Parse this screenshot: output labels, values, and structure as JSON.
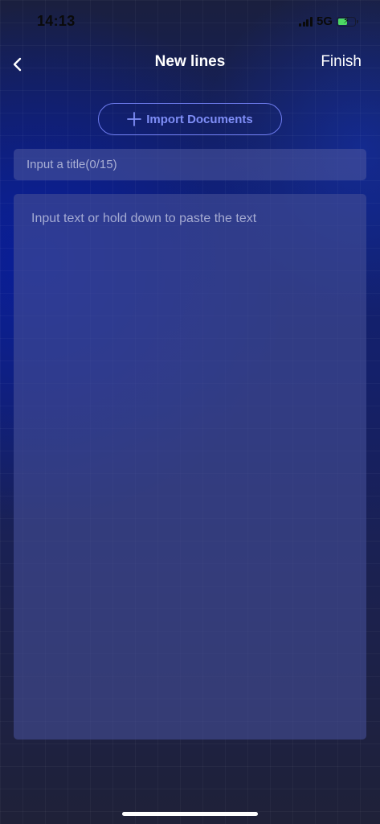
{
  "status_bar": {
    "time": "14:13",
    "network": "5G",
    "icons": [
      "signal-icon",
      "battery-charging-icon"
    ]
  },
  "nav": {
    "title": "New lines",
    "finish_label": "Finish",
    "back_icon": "chevron-left-icon"
  },
  "import": {
    "label": "Import Documents",
    "icon": "plus-icon"
  },
  "title_field": {
    "placeholder": "Input a title(0/15)",
    "value": ""
  },
  "body_field": {
    "placeholder": "Input text or hold down to paste the text",
    "value": ""
  },
  "colors": {
    "accent": "#7f8ef7",
    "accent_border": "#6f7df0",
    "battery_fill": "#4cd964"
  }
}
